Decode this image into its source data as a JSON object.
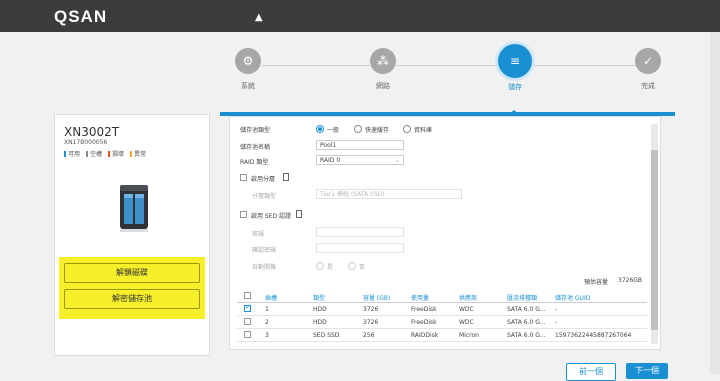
{
  "app": {
    "logo": "QSAN"
  },
  "steps": [
    {
      "label": "系統",
      "icon": "gear-icon",
      "glyph": "⚙"
    },
    {
      "label": "網路",
      "icon": "network-icon",
      "glyph": "⁂"
    },
    {
      "label": "儲存",
      "icon": "database-icon",
      "glyph": "≡"
    },
    {
      "label": "完成",
      "icon": "check-icon",
      "glyph": "✓"
    }
  ],
  "device": {
    "name": "XN3002T",
    "serial": "XN17B000056",
    "legend": [
      {
        "label": "可用",
        "color": "#1a8fd1"
      },
      {
        "label": "空槽",
        "color": "#888888"
      },
      {
        "label": "損壞",
        "color": "#e05020"
      },
      {
        "label": "異常",
        "color": "#f0a020"
      }
    ],
    "decrypt_disk_label": "解鎖磁碟",
    "decrypt_pool_label": "解密儲存池"
  },
  "form": {
    "pool_type_label": "儲存池類型",
    "pool_type_options": [
      "一般",
      "快速緩存",
      "資料庫"
    ],
    "pool_type_selected": "一般",
    "pool_name_label": "儲存池名稱",
    "pool_name_value": "Pool1",
    "raid_label": "RAID 類型",
    "raid_value": "RAID 0",
    "enable_tier_label": "啟用分層",
    "tier_type_label": "分層類型",
    "tier_type_value": "Tier1 模組 (SATA SSD)",
    "enable_sed_label": "啟用 SED 認證",
    "sed_password_label": "密碼",
    "sed_confirm_label": "確認密碼",
    "sed_auto_label": "自動開機",
    "sed_auto_options": [
      "是",
      "否"
    ],
    "sed_auto_selected": "是",
    "capacity_label": "預估容量",
    "capacity_value": "3726GB"
  },
  "table": {
    "columns": [
      "插槽",
      "類型",
      "容量 (GB)",
      "使用量",
      "供應商",
      "匯流排種類",
      "儲存池 GUID"
    ],
    "rows": [
      {
        "checked": true,
        "cells": [
          "1",
          "HDD",
          "3726",
          "FreeDisk",
          "WDC",
          "SATA 6.0 G...",
          "-"
        ]
      },
      {
        "checked": false,
        "cells": [
          "2",
          "HDD",
          "3726",
          "FreeDisk",
          "WDC",
          "SATA 6.0 G...",
          "-"
        ]
      },
      {
        "checked": false,
        "cells": [
          "3",
          "SED SSD",
          "256",
          "RAIDDisk",
          "Micron",
          "SATA 6.0 G...",
          "15973622445887267064"
        ]
      }
    ]
  },
  "nav": {
    "prev_label": "前一個",
    "next_label": "下一個"
  },
  "colors": {
    "accent": "#1a8fd1",
    "highlight": "#f6ef2a",
    "topbar": "#3c3c3c"
  }
}
